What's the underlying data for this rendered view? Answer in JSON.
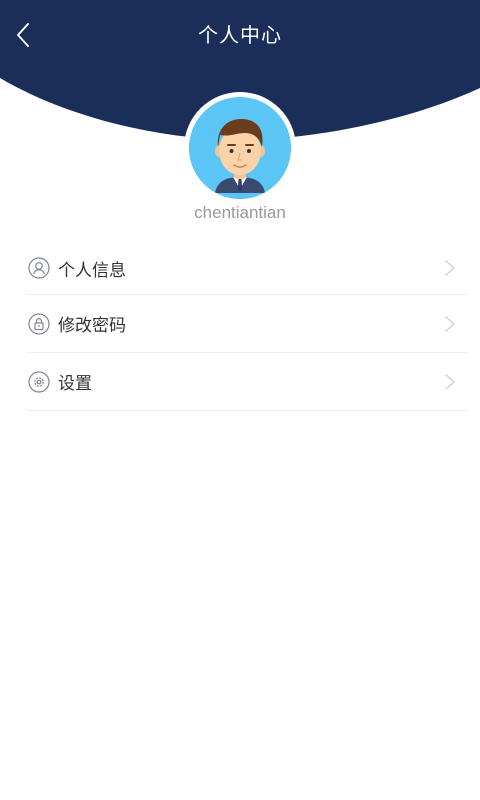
{
  "header": {
    "title": "个人中心",
    "back_icon": "chevron-left-icon",
    "background_color": "#1b2d59"
  },
  "profile": {
    "username": "chentiantian",
    "avatar_icon": "user-avatar-icon",
    "avatar_bg": "#5bc5f5"
  },
  "menu": {
    "items": [
      {
        "label": "个人信息",
        "icon": "user-icon"
      },
      {
        "label": "修改密码",
        "icon": "lock-icon"
      },
      {
        "label": "设置",
        "icon": "gear-icon"
      }
    ],
    "chevron_icon": "chevron-right-icon"
  }
}
